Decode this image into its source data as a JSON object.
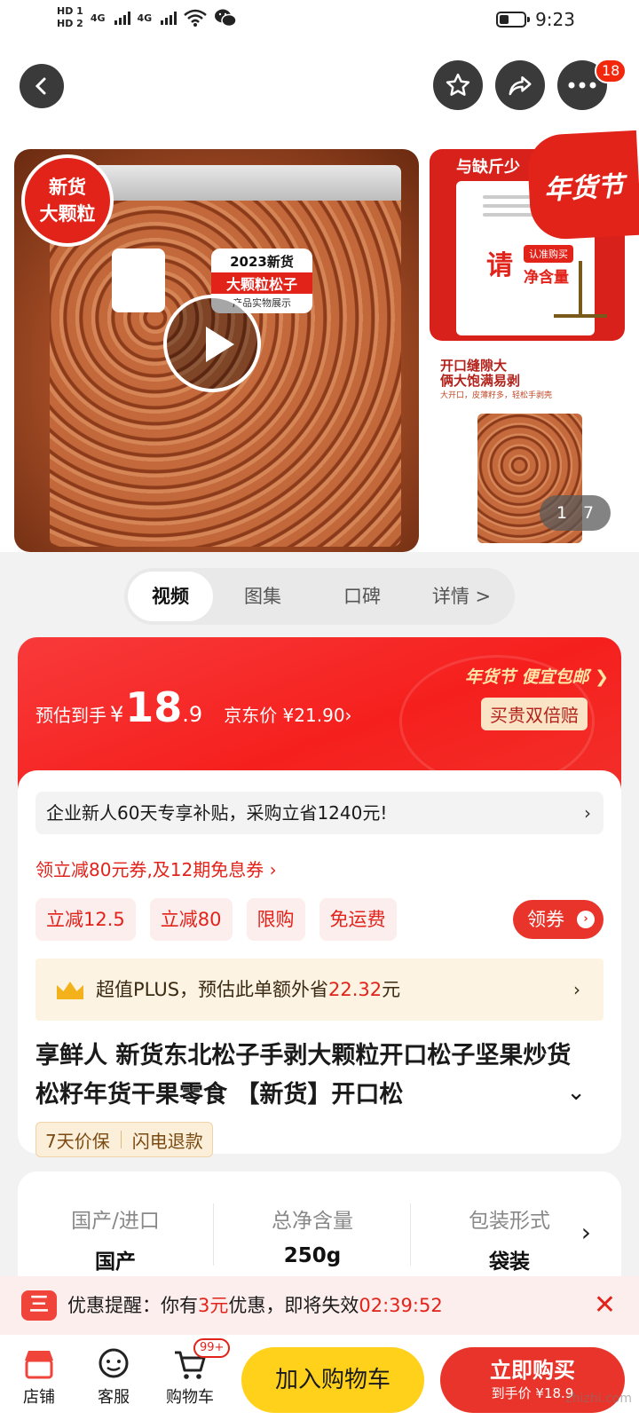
{
  "status_bar": {
    "hd1": "HD 1",
    "hd2": "HD 2",
    "signal1": "4G",
    "signal2": "4G",
    "time": "9:23"
  },
  "nav": {
    "cart_badge": "18"
  },
  "gallery": {
    "badge_line1": "新货",
    "badge_line2": "大颗粒",
    "bag_label_year": "2023新货",
    "bag_label_title": "大颗粒松子",
    "bag_label_sub": "产品实物展示",
    "thumb1_head": "与缺斤少",
    "thumb1_big": "请",
    "thumb1_pill": "认准购买",
    "thumb1_net": "净含量",
    "festival_label": "年货节",
    "thumb2_head_1": "开口缝隙大",
    "thumb2_head_2": "俩大饱满易剥",
    "thumb2_sub": "大开口，皮薄籽多，轻松手剥壳",
    "page_current": "1",
    "page_total": "7"
  },
  "media_tabs": [
    {
      "label": "视频",
      "active": true
    },
    {
      "label": "图集",
      "active": false
    },
    {
      "label": "口碑",
      "active": false
    },
    {
      "label": "详情 >",
      "active": false
    }
  ],
  "price": {
    "prefix": "预估到手",
    "currency": "¥",
    "integer": "18",
    "decimal": ".9",
    "jd_price": "京东价 ¥21.90›",
    "promo": "年货节  便宜包邮 ❯",
    "double_pay": "买贵双倍赔"
  },
  "coupons": {
    "enterprise": "企业新人60天专享补贴，采购立省1240元!",
    "link": "领立减80元券,及12期免息券 ›",
    "tags": [
      "立减12.5",
      "立减80",
      "限购",
      "免运费"
    ],
    "claim": "领券",
    "plus_prefix": "超值PLUS，预估此单额外省",
    "plus_amount": "22.32",
    "plus_suffix": "元"
  },
  "product": {
    "title": "享鲜人 新货东北松子手剥大颗粒开口松子坚果炒货松籽年货干果零食 【新货】开口松",
    "service1": "7天价保",
    "service2": "闪电退款"
  },
  "specs": [
    {
      "label": "国产/进口",
      "value": "国产"
    },
    {
      "label": "总净含量",
      "value": "250g"
    },
    {
      "label": "包装形式",
      "value": "袋装"
    }
  ],
  "reminder": {
    "prefix": "优惠提醒：你有",
    "amount": "3元",
    "middle": "优惠，即将失效",
    "countdown": "02:39:52"
  },
  "bottom": {
    "shop": "店铺",
    "service": "客服",
    "cart": "购物车",
    "cart_badge": "99+",
    "add_cart": "加入购物车",
    "buy_now": "立即购买",
    "buy_sub": "到手价 ¥18.9"
  },
  "watermark": "zhizhi.com",
  "colors": {
    "brand_red": "#e2231a",
    "yellow": "#ffd11a",
    "buy_red": "#e8342a"
  }
}
